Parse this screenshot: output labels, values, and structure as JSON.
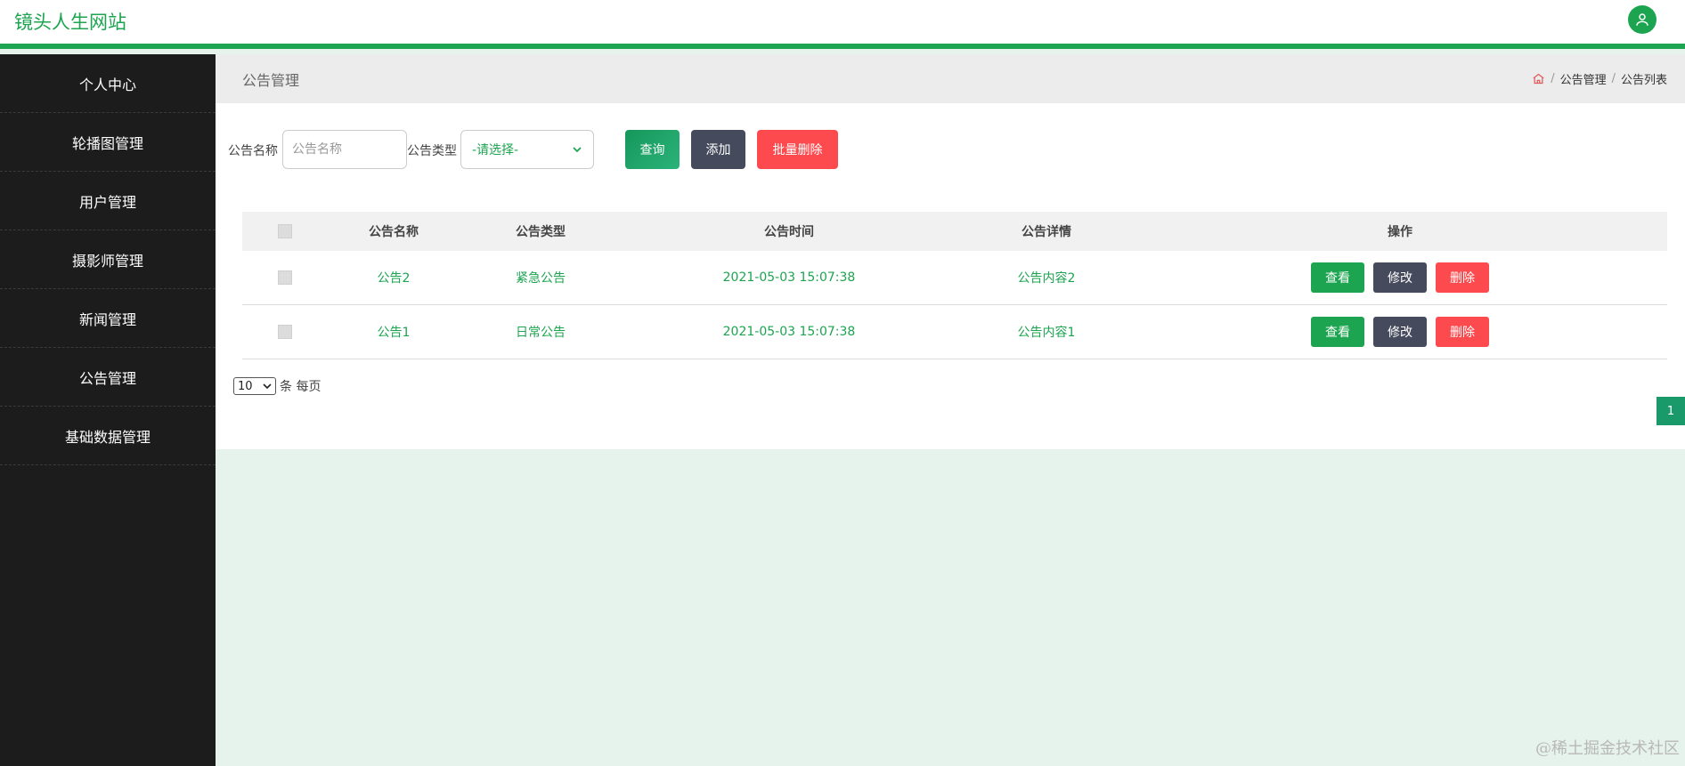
{
  "header": {
    "site_title": "镜头人生网站",
    "avatar_icon": "user-icon",
    "accent_color": "#1ca450"
  },
  "sidebar": {
    "items": [
      {
        "label": "个人中心"
      },
      {
        "label": "轮播图管理"
      },
      {
        "label": "用户管理"
      },
      {
        "label": "摄影师管理"
      },
      {
        "label": "新闻管理"
      },
      {
        "label": "公告管理"
      },
      {
        "label": "基础数据管理"
      }
    ]
  },
  "page": {
    "title": "公告管理",
    "breadcrumb": {
      "home_icon": "home-icon",
      "sep": "/",
      "items": [
        "公告管理",
        "公告列表"
      ]
    }
  },
  "search": {
    "name_label": "公告名称",
    "name_placeholder": "公告名称",
    "type_label": "公告类型",
    "type_selected": "-请选择-",
    "query_button": "查询",
    "add_button": "添加",
    "batch_delete_button": "批量删除"
  },
  "table": {
    "columns": [
      "公告名称",
      "公告类型",
      "公告时间",
      "公告详情",
      "操作"
    ],
    "rows": [
      {
        "name": "公告2",
        "type": "紧急公告",
        "time": "2021-05-03 15:07:38",
        "detail": "公告内容2"
      },
      {
        "name": "公告1",
        "type": "日常公告",
        "time": "2021-05-03 15:07:38",
        "detail": "公告内容1"
      }
    ],
    "actions": {
      "view": "查看",
      "edit": "修改",
      "delete": "删除"
    }
  },
  "pagination": {
    "page_size": "10",
    "page_size_suffix": "条 每页",
    "current_page": "1"
  },
  "watermark": "@稀土掘金技术社区"
}
